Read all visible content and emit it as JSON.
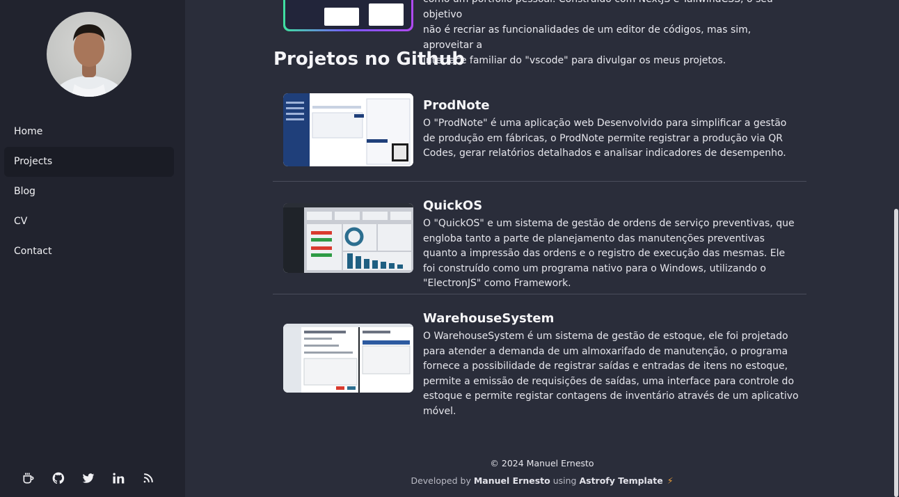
{
  "sidebar": {
    "nav": [
      {
        "label": "Home"
      },
      {
        "label": "Projects"
      },
      {
        "label": "Blog"
      },
      {
        "label": "CV"
      },
      {
        "label": "Contact"
      }
    ],
    "socials": [
      "coffee-icon",
      "github-icon",
      "twitter-icon",
      "linkedin-icon",
      "rss-icon"
    ]
  },
  "main": {
    "top_text_lines": [
      "como um portfolio pessoal. Construído com NextJS e TailwindCSS, o seu objetivo",
      "não é recriar as funcionalidades de um editor de códigos, mas sim, aproveitar a",
      "interface familiar do \"vscode\" para divulgar os meus projetos."
    ],
    "section_title": "Projetos no Github",
    "projects": [
      {
        "title": "ProdNote",
        "description": "O \"ProdNote\" é uma aplicação web Desenvolvido para simplificar a gestão de produção em fábricas, o ProdNote permite registrar a produção via QR Codes, gerar relatórios detalhados e analisar indicadores de desempenho."
      },
      {
        "title": "QuickOS",
        "description": "O \"QuickOS\" e um sistema de gestão de ordens de serviço preventivas, que engloba tanto a parte de planejamento das manutenções preventivas quanto a impressão das ordens e o registro de execução das mesmas. Ele foi construído como um programa nativo para o Windows, utilizando o \"ElectronJS\" como Framework."
      },
      {
        "title": "WarehouseSystem",
        "description": "O WarehouseSystem é um sistema de gestão de estoque, ele foi projetado para atender a demanda de um almoxarifado de manutenção, o programa fornece a possibilidade de registrar saídas e entradas de itens no estoque, permite a emissão de requisições de saídas, uma interface para controle do estoque e permite registar contagens de inventário através de um aplicativo móvel."
      }
    ]
  },
  "footer": {
    "copyright": "© 2024 Manuel Ernesto",
    "developed_by": "Developed by",
    "author": "Manuel Ernesto",
    "using": "using",
    "template": "Astrofy Template"
  },
  "colors": {
    "background": "#2a2d3a",
    "sidebar": "#21232e",
    "active_nav": "#1a1c25",
    "accent_bolt": "#f2a33a"
  }
}
